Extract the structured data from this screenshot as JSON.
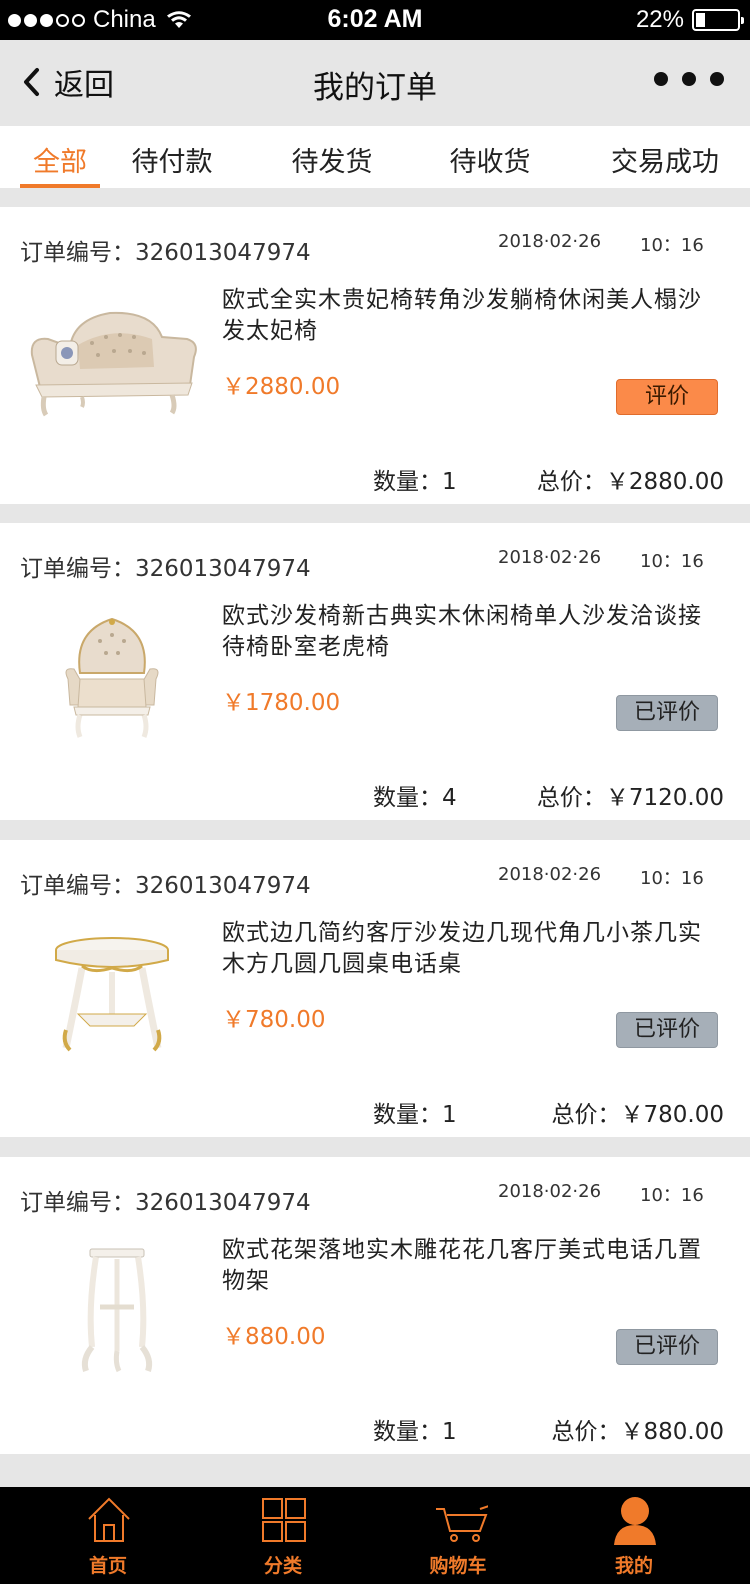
{
  "status_bar": {
    "carrier": "China",
    "time": "6:02 AM",
    "battery": "22%",
    "battery_level": 0.22
  },
  "nav": {
    "back_label": "返回",
    "title": "我的订单"
  },
  "tabs": [
    {
      "label": "全部",
      "active": true
    },
    {
      "label": "待付款",
      "active": false
    },
    {
      "label": "待发货",
      "active": false
    },
    {
      "label": "待收货",
      "active": false
    },
    {
      "label": "交易成功",
      "active": false
    }
  ],
  "orders": [
    {
      "order_no_label": "订单编号：",
      "order_no": "326013047974",
      "date": "2018·02·26",
      "time": "10：16",
      "name": "欧式全实木贵妃椅转角沙发躺椅休闲美人榻沙发太妃椅",
      "price": "￥2880.00",
      "review_label": "评价",
      "review_done": false,
      "qty_label": "数量：",
      "qty": "1",
      "total_label": "总价：",
      "total": "￥2880.00",
      "thumb": "chaise-lounge-icon"
    },
    {
      "order_no_label": "订单编号：",
      "order_no": "326013047974",
      "date": "2018·02·26",
      "time": "10：16",
      "name": "欧式沙发椅新古典实木休闲椅单人沙发洽谈接待椅卧室老虎椅",
      "price": "￥1780.00",
      "review_label": "已评价",
      "review_done": true,
      "qty_label": "数量：",
      "qty": "4",
      "total_label": "总价：",
      "total": "￥7120.00",
      "thumb": "armchair-icon"
    },
    {
      "order_no_label": "订单编号：",
      "order_no": "326013047974",
      "date": "2018·02·26",
      "time": "10：16",
      "name": "欧式边几简约客厅沙发边几现代角几小茶几实木方几圆几圆桌电话桌",
      "price": "￥780.00",
      "review_label": "已评价",
      "review_done": true,
      "qty_label": "数量：",
      "qty": "1",
      "total_label": "总价：",
      "total": "￥780.00",
      "thumb": "side-table-icon"
    },
    {
      "order_no_label": "订单编号：",
      "order_no": "326013047974",
      "date": "2018·02·26",
      "time": "10：16",
      "name": "欧式花架落地实木雕花花几客厅美式电话几置物架",
      "price": "￥880.00",
      "review_label": "已评价",
      "review_done": true,
      "qty_label": "数量：",
      "qty": "1",
      "total_label": "总价：",
      "total": "￥880.00",
      "thumb": "plant-stand-icon"
    }
  ],
  "tabbar": [
    {
      "label": "首页",
      "icon": "home-icon"
    },
    {
      "label": "分类",
      "icon": "category-grid-icon"
    },
    {
      "label": "购物车",
      "icon": "shopping-cart-icon"
    },
    {
      "label": "我的",
      "icon": "user-icon"
    }
  ],
  "colors": {
    "accent": "#f07a2a",
    "review_pending_bg": "#fb8a49",
    "review_done_bg": "#a6afb8",
    "page_bg": "#e6e6e6"
  }
}
